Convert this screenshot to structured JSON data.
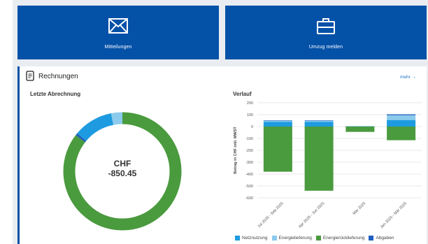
{
  "tiles": [
    {
      "label": "Mitteilungen",
      "icon": "envelope-icon"
    },
    {
      "label": "Umzug melden",
      "icon": "briefcase-icon"
    }
  ],
  "panel": {
    "title": "Rechnungen",
    "more_link": "mehr →",
    "icon": "document-icon"
  },
  "last_invoice": {
    "heading": "Letzte Abrechnung",
    "currency": "CHF",
    "amount": "-850.45",
    "segments": [
      {
        "name": "Energierücklieferung",
        "fraction": 0.855,
        "color": "#4a9a3e"
      },
      {
        "name": "Abgaben",
        "fraction": 0.006,
        "color": "#1f5fbf"
      },
      {
        "name": "Netznutzung",
        "fraction": 0.108,
        "color": "#1e9be0"
      },
      {
        "name": "Energielieferung",
        "fraction": 0.031,
        "color": "#8ccbed"
      }
    ]
  },
  "history": {
    "heading": "Verlauf"
  },
  "chart_data": {
    "type": "bar",
    "stacked": true,
    "categories": [
      "Jul 2025 - Sep 2025",
      "Apr 2025 - Jun 2025",
      "Mär 2025",
      "Jan 2025 - Mär 2025"
    ],
    "series": [
      {
        "name": "Netznutzung",
        "color": "#1e9be0",
        "values": [
          40,
          40,
          0,
          55
        ]
      },
      {
        "name": "Energielieferung",
        "color": "#8ccbed",
        "values": [
          10,
          10,
          5,
          40
        ]
      },
      {
        "name": "Energierücklieferung",
        "color": "#4a9a3e",
        "values": [
          -380,
          -540,
          -45,
          -115
        ]
      },
      {
        "name": "Abgaben",
        "color": "#1f5fbf",
        "values": [
          3,
          3,
          0,
          8
        ]
      }
    ],
    "ylabel": "Betrag in CHF inkl. MWST",
    "ylim": [
      -600,
      200
    ],
    "yticks": [
      200,
      100,
      0,
      -100,
      -200,
      -300,
      -400,
      -500,
      -600
    ],
    "grid": true,
    "legend_position": "bottom"
  }
}
